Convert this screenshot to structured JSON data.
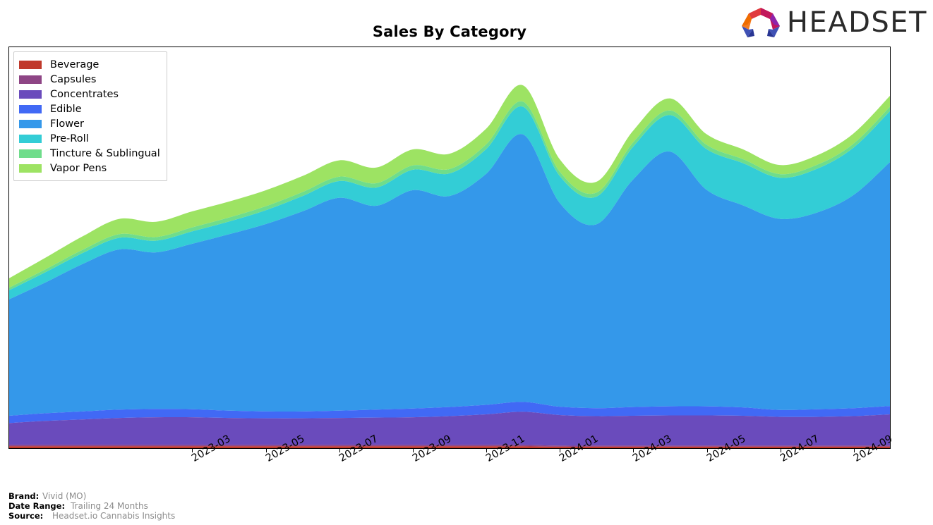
{
  "header": {
    "title": "Sales By Category",
    "logo_text": "HEADSET",
    "logo_icon": "headset-arch-logo"
  },
  "legend": {
    "position": "top-left",
    "items": [
      {
        "label": "Beverage",
        "color": "#c0392b"
      },
      {
        "label": "Capsules",
        "color": "#8e4585"
      },
      {
        "label": "Concentrates",
        "color": "#6a4bbc"
      },
      {
        "label": "Edible",
        "color": "#4169f5"
      },
      {
        "label": "Flower",
        "color": "#3498ea"
      },
      {
        "label": "Pre-Roll",
        "color": "#33cdd6"
      },
      {
        "label": "Tincture & Sublingual",
        "color": "#6fdd8b"
      },
      {
        "label": "Vapor Pens",
        "color": "#9de363"
      }
    ]
  },
  "footer": {
    "brand_key": "Brand:",
    "brand_value": "Vivid (MO)",
    "date_key": "Date Range:",
    "date_value": "Trailing 24 Months",
    "source_key": "Source:",
    "source_value": "Headset.io Cannabis Insights"
  },
  "chart_data": {
    "type": "area",
    "stacked": true,
    "title": "Sales By Category",
    "xlabel": "",
    "ylabel": "",
    "grid": false,
    "legend_position": "top-left",
    "y_axis_labels_shown": false,
    "ylim": [
      0,
      100
    ],
    "x_tick_labels": [
      "2023-03",
      "2023-05",
      "2023-07",
      "2023-09",
      "2023-11",
      "2024-01",
      "2024-03",
      "2024-05",
      "2024-07",
      "2024-09"
    ],
    "x": [
      "2022-10",
      "2022-11",
      "2022-12",
      "2023-01",
      "2023-02",
      "2023-03",
      "2023-04",
      "2023-05",
      "2023-06",
      "2023-07",
      "2023-08",
      "2023-09",
      "2023-10",
      "2023-11",
      "2023-12",
      "2024-01",
      "2024-02",
      "2024-03",
      "2024-04",
      "2024-05",
      "2024-06",
      "2024-07",
      "2024-08",
      "2024-09",
      "2024-10"
    ],
    "series": [
      {
        "name": "Beverage",
        "color": "#c0392b",
        "values": [
          0.5,
          0.5,
          0.5,
          0.5,
          0.5,
          0.5,
          0.5,
          0.5,
          0.5,
          0.5,
          0.5,
          0.5,
          0.5,
          0.5,
          0.5,
          0.4,
          0.4,
          0.4,
          0.4,
          0.4,
          0.4,
          0.4,
          0.4,
          0.4,
          0.4
        ]
      },
      {
        "name": "Capsules",
        "color": "#8e4585",
        "values": [
          0.4,
          0.4,
          0.4,
          0.4,
          0.4,
          0.4,
          0.4,
          0.4,
          0.4,
          0.4,
          0.4,
          0.4,
          0.4,
          0.4,
          0.4,
          0.3,
          0.3,
          0.3,
          0.3,
          0.3,
          0.3,
          0.3,
          0.3,
          0.3,
          0.3
        ]
      },
      {
        "name": "Concentrates",
        "color": "#6a4bbc",
        "values": [
          6.0,
          6.6,
          7.0,
          7.4,
          7.6,
          7.6,
          7.4,
          7.3,
          7.3,
          7.4,
          7.5,
          7.6,
          7.9,
          8.4,
          9.1,
          8.4,
          8.1,
          8.2,
          8.3,
          8.3,
          8.2,
          7.9,
          7.9,
          8.1,
          8.6
        ]
      },
      {
        "name": "Edible",
        "color": "#4169f5",
        "values": [
          2.0,
          2.1,
          2.2,
          2.3,
          2.3,
          2.2,
          2.0,
          1.9,
          1.9,
          2.0,
          2.2,
          2.4,
          2.5,
          2.6,
          2.7,
          2.3,
          2.2,
          2.4,
          2.5,
          2.5,
          2.3,
          1.9,
          2.1,
          2.2,
          2.3
        ]
      },
      {
        "name": "Flower",
        "color": "#3498ea",
        "values": [
          32.0,
          36.0,
          40.5,
          44.0,
          43.0,
          45.5,
          48.5,
          51.5,
          55.0,
          58.5,
          56.0,
          60.0,
          58.0,
          63.5,
          73.5,
          56.0,
          50.5,
          62.5,
          70.0,
          59.5,
          55.5,
          52.5,
          54.0,
          58.5,
          67.0
        ]
      },
      {
        "name": "Pre-Roll",
        "color": "#33cdd6",
        "values": [
          2.5,
          2.8,
          3.0,
          3.2,
          3.2,
          3.4,
          3.5,
          3.8,
          4.2,
          4.6,
          5.0,
          5.6,
          6.2,
          6.8,
          7.6,
          7.4,
          7.6,
          9.0,
          10.0,
          11.2,
          11.6,
          11.3,
          12.0,
          13.0,
          14.0
        ]
      },
      {
        "name": "Tincture & Sublingual",
        "color": "#6fdd8b",
        "values": [
          0.7,
          0.8,
          0.9,
          1.0,
          1.0,
          1.1,
          1.1,
          1.1,
          1.1,
          1.2,
          1.2,
          1.2,
          1.2,
          1.3,
          1.4,
          1.2,
          1.1,
          1.2,
          1.3,
          1.2,
          1.1,
          1.0,
          1.1,
          1.1,
          1.2
        ]
      },
      {
        "name": "Vapor Pens",
        "color": "#9de363",
        "values": [
          2.6,
          3.2,
          3.7,
          4.2,
          4.2,
          4.4,
          4.4,
          4.4,
          4.4,
          4.5,
          4.3,
          4.4,
          4.2,
          4.3,
          4.5,
          3.4,
          3.0,
          3.2,
          3.3,
          2.9,
          2.7,
          2.5,
          2.6,
          2.8,
          3.0
        ]
      }
    ]
  }
}
